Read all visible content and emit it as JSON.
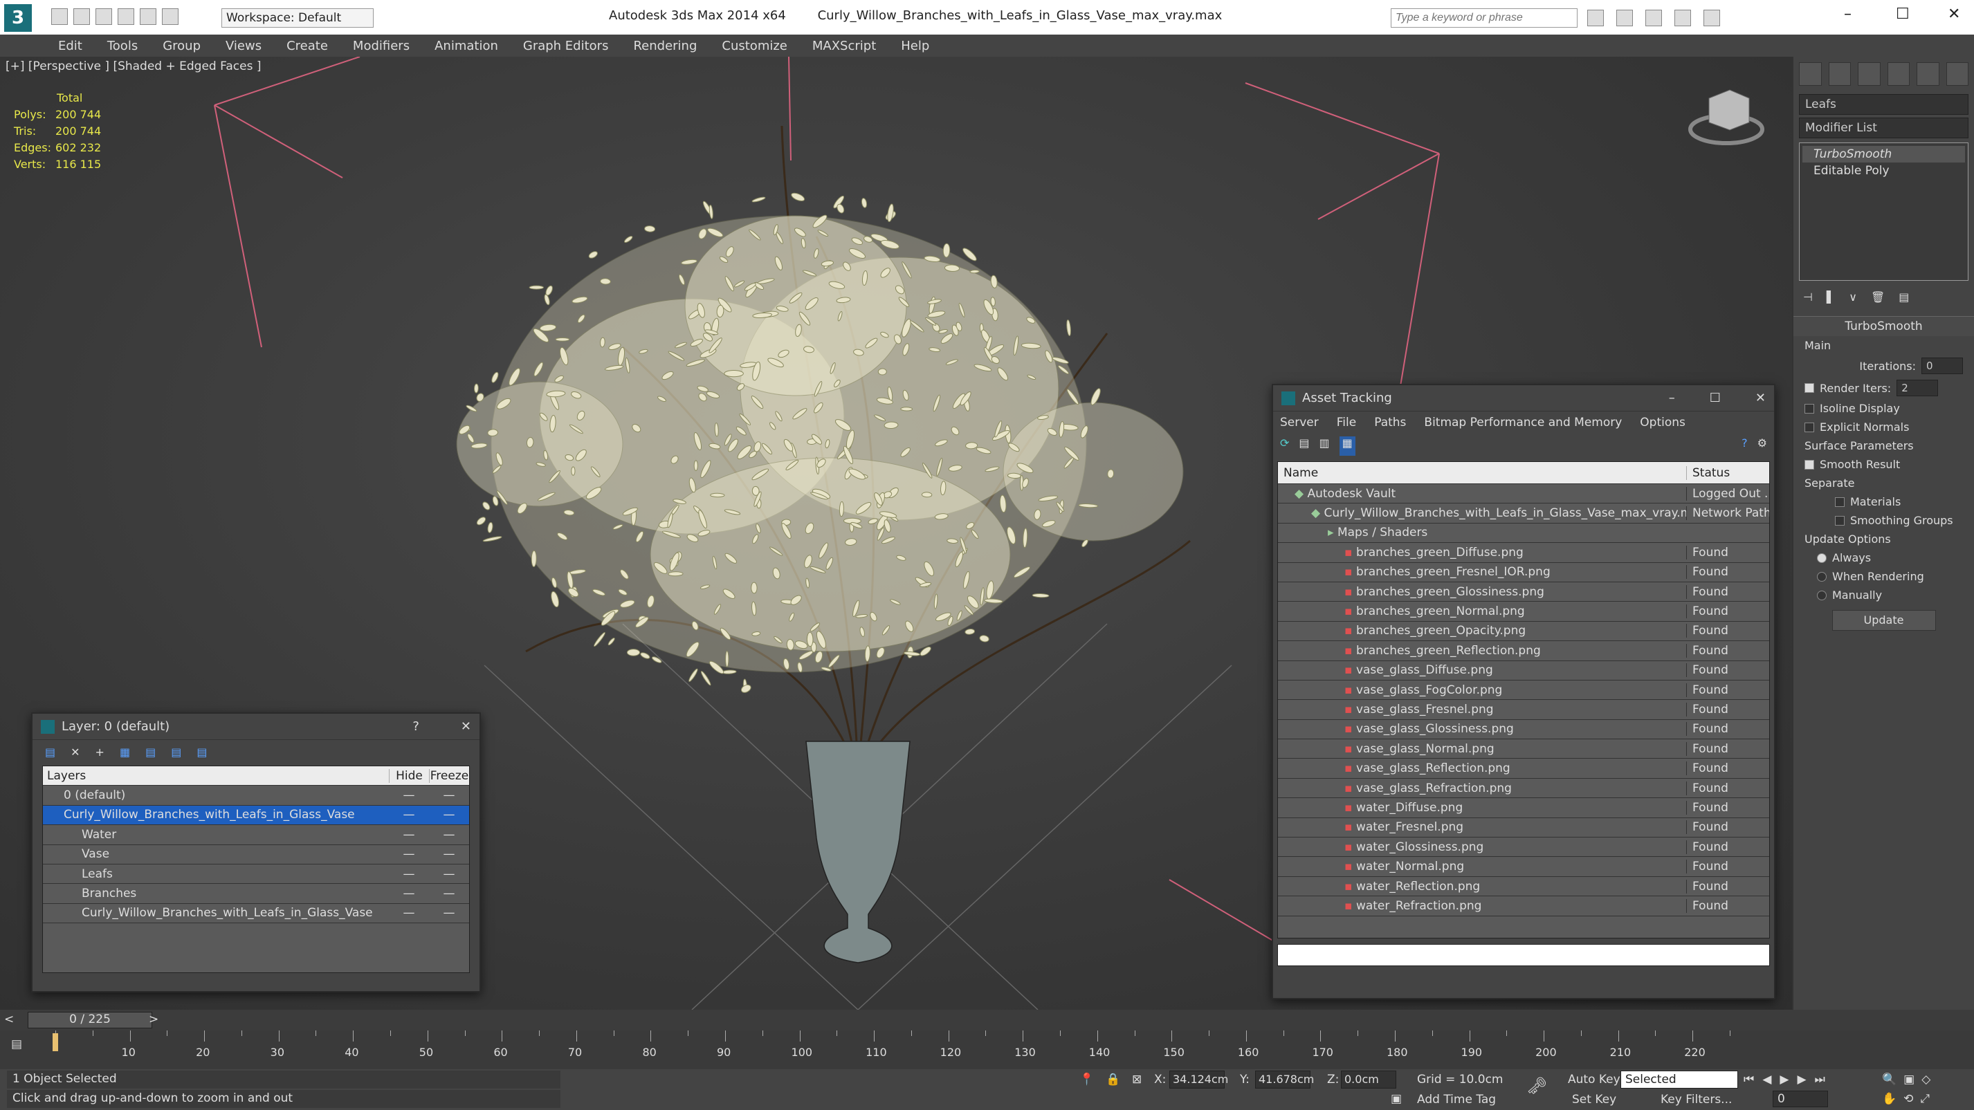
{
  "app": {
    "title": "Autodesk 3ds Max  2014 x64",
    "file": "Curly_Willow_Branches_with_Leafs_in_Glass_Vase_max_vray.max",
    "workspace": "Workspace: Default",
    "search_placeholder": "Type a keyword or phrase"
  },
  "menu": [
    "Edit",
    "Tools",
    "Group",
    "Views",
    "Create",
    "Modifiers",
    "Animation",
    "Graph Editors",
    "Rendering",
    "Customize",
    "MAXScript",
    "Help"
  ],
  "viewport": {
    "label": "[+] [Perspective ] [Shaded + Edged Faces ]",
    "stats": {
      "header": "Total",
      "rows": [
        {
          "k": "Polys:",
          "v": "200 744"
        },
        {
          "k": "Tris:",
          "v": "200 744"
        },
        {
          "k": "Edges:",
          "v": "602 232"
        },
        {
          "k": "Verts:",
          "v": "116 115"
        }
      ]
    }
  },
  "command_panel": {
    "object_name": "Leafs",
    "modifier_list": "Modifier List",
    "stack": [
      "TurboSmooth",
      "Editable Poly"
    ],
    "rollout": "TurboSmooth",
    "main_label": "Main",
    "iterations_label": "Iterations:",
    "iterations_value": "0",
    "render_iters_label": "Render Iters:",
    "render_iters_value": "2",
    "isoline": "Isoline Display",
    "explicit": "Explicit Normals",
    "surface_params": "Surface Parameters",
    "smooth_result": "Smooth Result",
    "separate": "Separate",
    "materials": "Materials",
    "smoothing_groups": "Smoothing Groups",
    "update_options": "Update Options",
    "always": "Always",
    "when_rendering": "When Rendering",
    "manually": "Manually",
    "update_btn": "Update"
  },
  "layer_dialog": {
    "title": "Layer: 0 (default)",
    "help": "?",
    "cols": {
      "layers": "Layers",
      "hide": "Hide",
      "freeze": "Freeze"
    },
    "rows": [
      {
        "name": "0 (default)",
        "indent": 0,
        "sel": false
      },
      {
        "name": "Curly_Willow_Branches_with_Leafs_in_Glass_Vase",
        "indent": 0,
        "sel": true
      },
      {
        "name": "Water",
        "indent": 1,
        "sel": false
      },
      {
        "name": "Vase",
        "indent": 1,
        "sel": false
      },
      {
        "name": "Leafs",
        "indent": 1,
        "sel": false
      },
      {
        "name": "Branches",
        "indent": 1,
        "sel": false
      },
      {
        "name": "Curly_Willow_Branches_with_Leafs_in_Glass_Vase",
        "indent": 1,
        "sel": false
      }
    ]
  },
  "asset_tracking": {
    "title": "Asset Tracking",
    "menu": [
      "Server",
      "File",
      "Paths",
      "Bitmap Performance and Memory",
      "Options"
    ],
    "cols": {
      "name": "Name",
      "status": "Status"
    },
    "rows": [
      {
        "name": "Autodesk Vault",
        "status": "Logged Out ...",
        "indent": 1
      },
      {
        "name": "Curly_Willow_Branches_with_Leafs_in_Glass_Vase_max_vray.max",
        "status": "Network Path",
        "indent": 2
      },
      {
        "name": "Maps / Shaders",
        "status": "",
        "indent": 3
      },
      {
        "name": "branches_green_Diffuse.png",
        "status": "Found",
        "indent": 4
      },
      {
        "name": "branches_green_Fresnel_IOR.png",
        "status": "Found",
        "indent": 4
      },
      {
        "name": "branches_green_Glossiness.png",
        "status": "Found",
        "indent": 4
      },
      {
        "name": "branches_green_Normal.png",
        "status": "Found",
        "indent": 4
      },
      {
        "name": "branches_green_Opacity.png",
        "status": "Found",
        "indent": 4
      },
      {
        "name": "branches_green_Reflection.png",
        "status": "Found",
        "indent": 4
      },
      {
        "name": "vase_glass_Diffuse.png",
        "status": "Found",
        "indent": 4
      },
      {
        "name": "vase_glass_FogColor.png",
        "status": "Found",
        "indent": 4
      },
      {
        "name": "vase_glass_Fresnel.png",
        "status": "Found",
        "indent": 4
      },
      {
        "name": "vase_glass_Glossiness.png",
        "status": "Found",
        "indent": 4
      },
      {
        "name": "vase_glass_Normal.png",
        "status": "Found",
        "indent": 4
      },
      {
        "name": "vase_glass_Reflection.png",
        "status": "Found",
        "indent": 4
      },
      {
        "name": "vase_glass_Refraction.png",
        "status": "Found",
        "indent": 4
      },
      {
        "name": "water_Diffuse.png",
        "status": "Found",
        "indent": 4
      },
      {
        "name": "water_Fresnel.png",
        "status": "Found",
        "indent": 4
      },
      {
        "name": "water_Glossiness.png",
        "status": "Found",
        "indent": 4
      },
      {
        "name": "water_Normal.png",
        "status": "Found",
        "indent": 4
      },
      {
        "name": "water_Reflection.png",
        "status": "Found",
        "indent": 4
      },
      {
        "name": "water_Refraction.png",
        "status": "Found",
        "indent": 4
      }
    ]
  },
  "timeline": {
    "frame": "0 / 225",
    "ticks": [
      "10",
      "20",
      "30",
      "40",
      "50",
      "60",
      "70",
      "80",
      "90",
      "100",
      "110",
      "120",
      "130",
      "140",
      "150",
      "160",
      "170",
      "180",
      "190",
      "200",
      "210",
      "220"
    ]
  },
  "status": {
    "selected": "1 Object Selected",
    "hint": "Click and drag up-and-down to zoom in and out",
    "x_label": "X:",
    "x": "34.124cm",
    "y_label": "Y:",
    "y": "41.678cm",
    "z_label": "Z:",
    "z": "0.0cm",
    "grid": "Grid = 10.0cm",
    "add_time_tag": "Add Time Tag",
    "auto_key": "Auto Key",
    "set_key": "Set Key",
    "selected_dd": "Selected",
    "key_filters": "Key Filters...",
    "frame_field": "0"
  }
}
